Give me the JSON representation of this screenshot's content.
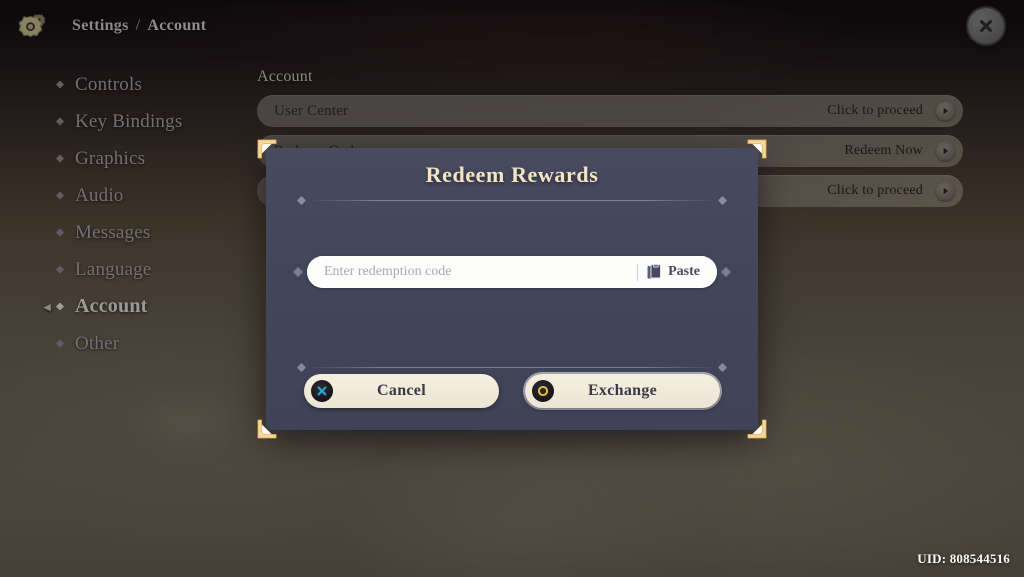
{
  "header": {
    "gear_icon": "gear-icon",
    "breadcrumb_root": "Settings",
    "breadcrumb_separator": "/",
    "breadcrumb_current": "Account",
    "close_icon": "close-icon"
  },
  "sidebar": {
    "items": [
      {
        "label": "Controls",
        "active": false
      },
      {
        "label": "Key Bindings",
        "active": false
      },
      {
        "label": "Graphics",
        "active": false
      },
      {
        "label": "Audio",
        "active": false
      },
      {
        "label": "Messages",
        "active": false
      },
      {
        "label": "Language",
        "active": false
      },
      {
        "label": "Account",
        "active": true
      },
      {
        "label": "Other",
        "active": false
      }
    ]
  },
  "content": {
    "section_title": "Account",
    "rows": [
      {
        "label": "User Center",
        "action": "Click to proceed",
        "arrow_icon": "arrow-right-circle-icon"
      },
      {
        "label": "Redeem Code",
        "action": "Redeem Now",
        "arrow_icon": "arrow-right-circle-icon"
      },
      {
        "label": "",
        "action": "Click to proceed",
        "arrow_icon": "arrow-right-circle-icon"
      }
    ]
  },
  "modal": {
    "title": "Redeem Rewards",
    "input": {
      "value": "",
      "placeholder": "Enter redemption code"
    },
    "paste_button": {
      "label": "Paste",
      "icon": "clipboard-paste-icon"
    },
    "buttons": [
      {
        "label": "Cancel",
        "icon": "cancel-x-icon",
        "style": "cancel"
      },
      {
        "label": "Exchange",
        "icon": "confirm-ring-icon",
        "style": "exchange"
      }
    ]
  },
  "footer": {
    "uid": "UID: 808544516"
  },
  "colors": {
    "gold": "#f2e4c4",
    "panel": "#43465a",
    "button_cream": "#f0e9d8",
    "accent_blue": "#2f9fd8",
    "accent_yellow": "#e8c53a"
  }
}
